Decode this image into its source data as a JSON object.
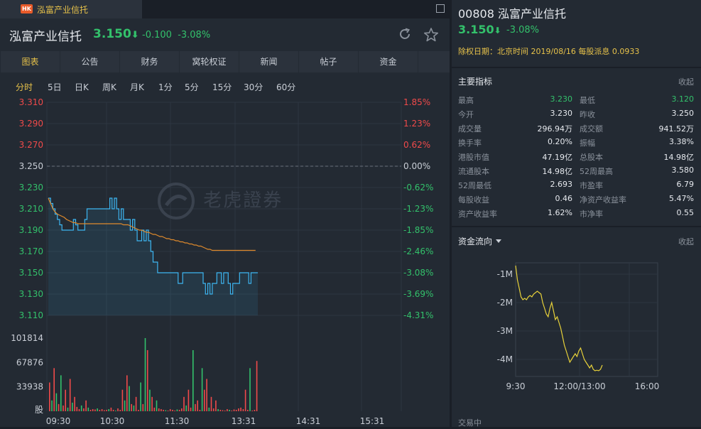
{
  "tabbar": {
    "tab_badge": "HK",
    "tab_label": "泓富产业信托"
  },
  "header": {
    "name": "泓富产业信托",
    "price": "3.150",
    "price_arrow": "⬇",
    "change": "-0.100",
    "change_pct": "-3.08%"
  },
  "nav": [
    "图表",
    "公告",
    "财务",
    "窝轮权证",
    "新闻",
    "帖子",
    "资金"
  ],
  "periods": [
    "分时",
    "5日",
    "日K",
    "周K",
    "月K",
    "1分",
    "5分",
    "15分",
    "30分",
    "60分"
  ],
  "chart": {
    "price_ticks": [
      "3.310",
      "3.290",
      "3.270",
      "3.250",
      "3.230",
      "3.210",
      "3.190",
      "3.170",
      "3.150",
      "3.130",
      "3.110"
    ],
    "pct_ticks": [
      "1.85%",
      "1.23%",
      "0.62%",
      "0.00%",
      "-0.62%",
      "-1.23%",
      "-1.85%",
      "-2.46%",
      "-3.08%",
      "-3.69%",
      "-4.31%"
    ],
    "volume_ticks": [
      "101814",
      "67876",
      "33938",
      "股"
    ],
    "time_ticks": [
      "09:30",
      "10:30",
      "11:30",
      "13:31",
      "14:31",
      "15:31"
    ],
    "watermark": "老虎證券",
    "colors": {
      "up": "#f04a4a",
      "down": "#33c16b",
      "flat": "#c9ced6",
      "price_line": "#3db6f2",
      "avg_line": "#e08a2c"
    }
  },
  "chart_data": {
    "type": "line",
    "ylim": [
      3.11,
      3.31
    ],
    "prev_close": 3.25,
    "series": [
      {
        "values": [
          3.22,
          3.215,
          3.21,
          3.205,
          3.2,
          3.195,
          3.19,
          3.19,
          3.19,
          3.19,
          3.19,
          3.2,
          3.195,
          3.19,
          3.19,
          3.19,
          3.2,
          3.21,
          3.21,
          3.21,
          3.21,
          3.21,
          3.21,
          3.21,
          3.21,
          3.21,
          3.21,
          3.22,
          3.21,
          3.22,
          3.21,
          3.2,
          3.21,
          3.2,
          3.2,
          3.2,
          3.19,
          3.2,
          3.19,
          3.18,
          3.18,
          3.19,
          3.18,
          3.19,
          3.18,
          3.17,
          3.16,
          3.16,
          3.15,
          3.15,
          3.15,
          3.15,
          3.15,
          3.15,
          3.15,
          3.15,
          3.15,
          3.14,
          3.14,
          3.15,
          3.15,
          3.15,
          3.15,
          3.15,
          3.15,
          3.15,
          3.15,
          3.15,
          3.14,
          3.13,
          3.14,
          3.13,
          3.14,
          3.14,
          3.15,
          3.15,
          3.14,
          3.15,
          3.15,
          3.14,
          3.13,
          3.14,
          3.14,
          3.14,
          3.15,
          3.15,
          3.15,
          3.15,
          3.14,
          3.15,
          3.15,
          3.15
        ]
      },
      {
        "values": [
          3.22,
          3.215,
          3.21,
          3.207,
          3.205,
          3.204,
          3.203,
          3.202,
          3.2,
          3.199,
          3.198,
          3.197,
          3.197,
          3.196,
          3.196,
          3.196,
          3.196,
          3.196,
          3.196,
          3.196,
          3.196,
          3.196,
          3.196,
          3.196,
          3.196,
          3.196,
          3.196,
          3.196,
          3.196,
          3.196,
          3.196,
          3.196,
          3.196,
          3.195,
          3.195,
          3.195,
          3.194,
          3.193,
          3.192,
          3.191,
          3.19,
          3.19,
          3.189,
          3.188,
          3.188,
          3.187,
          3.186,
          3.186,
          3.185,
          3.184,
          3.184,
          3.183,
          3.182,
          3.182,
          3.181,
          3.181,
          3.18,
          3.18,
          3.179,
          3.179,
          3.178,
          3.178,
          3.177,
          3.177,
          3.176,
          3.176,
          3.175,
          3.175,
          3.174,
          3.173,
          3.172,
          3.172,
          3.171,
          3.171,
          3.171,
          3.171,
          3.171,
          3.171,
          3.171,
          3.171,
          3.171,
          3.171,
          3.171,
          3.171,
          3.171,
          3.171,
          3.171,
          3.171,
          3.171,
          3.171,
          3.171,
          3.171
        ]
      }
    ],
    "volume": {
      "ylim": [
        0,
        101814
      ],
      "values": [
        40000,
        15000,
        60000,
        25000,
        10000,
        50000,
        8000,
        30000,
        5000,
        45000,
        12000,
        20000,
        6000,
        3000,
        8000,
        4000,
        15000,
        5000,
        2000,
        3000,
        2500,
        4000,
        2000,
        3000,
        1500,
        2000,
        3000,
        5000,
        2000,
        1000,
        4000,
        2000,
        30000,
        15000,
        50000,
        35000,
        10000,
        8000,
        20000,
        2000,
        40000,
        10000,
        101814,
        85000,
        30000,
        20000,
        5000,
        15000,
        4000,
        3000,
        2000,
        1500,
        1000,
        3000,
        2000,
        1000,
        2500,
        2000,
        4000,
        20000,
        8000,
        30000,
        5000,
        85000,
        10000,
        15000,
        2000,
        60000,
        30000,
        45000,
        5000,
        20000,
        4000,
        15000,
        3000,
        2000,
        1500,
        1000,
        3000,
        2000,
        1000,
        2500,
        2000,
        4000,
        5000,
        3000,
        30000,
        2000,
        60000,
        1000,
        2000,
        70000
      ],
      "colors": [
        "up",
        "down",
        "up",
        "down",
        "up",
        "down",
        "up",
        "up",
        "down",
        "up",
        "down",
        "up",
        "up",
        "up",
        "down",
        "up",
        "up",
        "down",
        "up",
        "up",
        "up",
        "down",
        "up",
        "up",
        "up",
        "up",
        "down",
        "up",
        "up",
        "down",
        "up",
        "up",
        "up",
        "down",
        "up",
        "down",
        "up",
        "down",
        "up",
        "up",
        "down",
        "up",
        "down",
        "up",
        "down",
        "up",
        "up",
        "down",
        "up",
        "up",
        "up",
        "down",
        "up",
        "up",
        "up",
        "up",
        "down",
        "up",
        "up",
        "up",
        "down",
        "up",
        "up",
        "down",
        "up",
        "up",
        "up",
        "down",
        "up",
        "up",
        "down",
        "up",
        "up",
        "up",
        "down",
        "up",
        "up",
        "up",
        "up",
        "down",
        "up",
        "up",
        "up",
        "up",
        "up",
        "up",
        "up",
        "up",
        "down",
        "up",
        "up",
        "up"
      ]
    }
  },
  "right": {
    "code": "00808",
    "name": "泓富产业信托",
    "price": "3.150",
    "price_arrow": "⬇",
    "change_pct": "-3.08%",
    "dividend": "除权日期：北京时间 2019/08/16 每股派息 0.0933",
    "metrics_title": "主要指标",
    "collapse_label": "收起",
    "metrics": [
      {
        "k1": "最高",
        "v1": "3.230",
        "c1": "green",
        "k2": "最低",
        "v2": "3.120",
        "c2": "green"
      },
      {
        "k1": "今开",
        "v1": "3.230",
        "c1": "white",
        "k2": "昨收",
        "v2": "3.250",
        "c2": "white"
      },
      {
        "k1": "成交量",
        "v1": "296.94万",
        "c1": "white",
        "k2": "成交额",
        "v2": "941.52万",
        "c2": "white"
      },
      {
        "k1": "换手率",
        "v1": "0.20%",
        "c1": "white",
        "k2": "振幅",
        "v2": "3.38%",
        "c2": "white"
      },
      {
        "k1": "港股市值",
        "v1": "47.19亿",
        "c1": "white",
        "k2": "总股本",
        "v2": "14.98亿",
        "c2": "white"
      },
      {
        "k1": "流通股本",
        "v1": "14.98亿",
        "c1": "white",
        "k2": "52周最高",
        "v2": "3.580",
        "c2": "white"
      },
      {
        "k1": "52周最低",
        "v1": "2.693",
        "c1": "white",
        "k2": "市盈率",
        "v2": "6.79",
        "c2": "white"
      },
      {
        "k1": "每股收益",
        "v1": "0.46",
        "c1": "white",
        "k2": "净资产收益率",
        "v2": "5.47%",
        "c2": "white"
      },
      {
        "k1": "资产收益率",
        "v1": "1.62%",
        "c1": "white",
        "k2": "市净率",
        "v2": "0.55",
        "c2": "white"
      }
    ],
    "fund_title": "资金流向",
    "fund_collapse": "收起",
    "fund_chart": {
      "y_ticks": [
        "-1M",
        "-2M",
        "-3M",
        "-4M"
      ],
      "x_ticks": [
        "9:30",
        "12:00/13:00",
        "16:00"
      ]
    },
    "status": "交易中"
  },
  "fund_chart_data": {
    "type": "line",
    "ylim": [
      -4.6,
      -0.6
    ],
    "values": [
      -0.7,
      -1.2,
      -1.5,
      -1.8,
      -1.9,
      -1.85,
      -1.9,
      -1.8,
      -1.75,
      -1.8,
      -1.7,
      -1.65,
      -1.6,
      -1.65,
      -1.7,
      -2.0,
      -2.2,
      -2.4,
      -2.5,
      -2.2,
      -2.0,
      -2.3,
      -2.6,
      -2.5,
      -2.7,
      -2.9,
      -3.2,
      -3.5,
      -3.7,
      -3.9,
      -4.1,
      -4.0,
      -3.9,
      -3.8,
      -3.9,
      -3.7,
      -3.6,
      -3.8,
      -4.0,
      -4.1,
      -4.2,
      -4.3,
      -4.2,
      -4.35,
      -4.4,
      -4.38,
      -4.4,
      -4.35,
      -4.2
    ]
  }
}
